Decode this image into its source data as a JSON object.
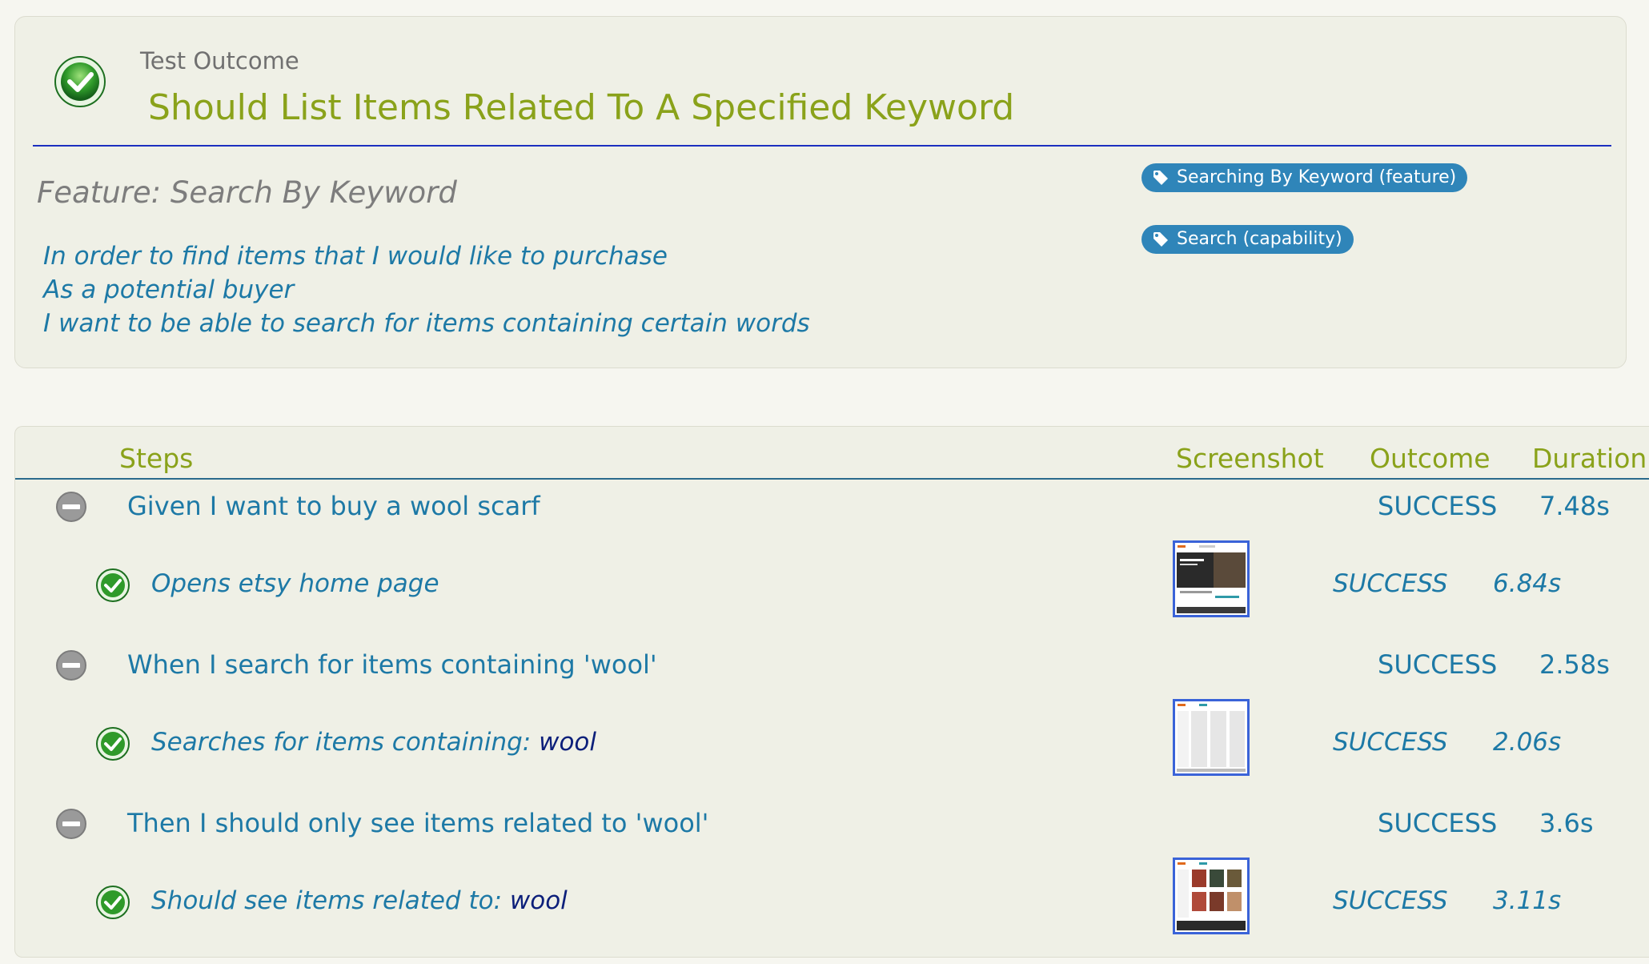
{
  "outcome": {
    "label": "Test Outcome",
    "title": "Should List Items Related To A Specified Keyword",
    "status_icon": "success-check-icon"
  },
  "feature": {
    "heading": "Feature: Search By Keyword",
    "narrative": [
      "In order to find items that I would like to purchase",
      "As a potential buyer",
      "I want to be able to search for items containing certain words"
    ],
    "tags": [
      "Searching By Keyword (feature)",
      "Search (capability)"
    ]
  },
  "steps_table": {
    "headers": {
      "steps": "Steps",
      "screenshot": "Screenshot",
      "outcome": "Outcome",
      "duration": "Duration"
    },
    "steps": [
      {
        "text": "Given I want to buy a wool scarf",
        "outcome": "SUCCESS",
        "duration": "7.48s",
        "sub": {
          "text": "Opens etsy home page",
          "arg": "",
          "outcome": "SUCCESS",
          "duration": "6.84s"
        }
      },
      {
        "text": "When I search for items containing 'wool'",
        "outcome": "SUCCESS",
        "duration": "2.58s",
        "sub": {
          "text": "Searches for items containing: ",
          "arg": "wool",
          "outcome": "SUCCESS",
          "duration": "2.06s"
        }
      },
      {
        "text": "Then I should only see items related to 'wool'",
        "outcome": "SUCCESS",
        "duration": "3.6s",
        "sub": {
          "text": "Should see items related to: ",
          "arg": "wool",
          "outcome": "SUCCESS",
          "duration": "3.11s"
        }
      }
    ]
  },
  "colors": {
    "title_green": "#8aa21a",
    "text_blue": "#1d79a6",
    "tag_blue": "#2f85b9",
    "rule_blue": "#1b2fbf",
    "argument_navy": "#0c1f7a"
  }
}
